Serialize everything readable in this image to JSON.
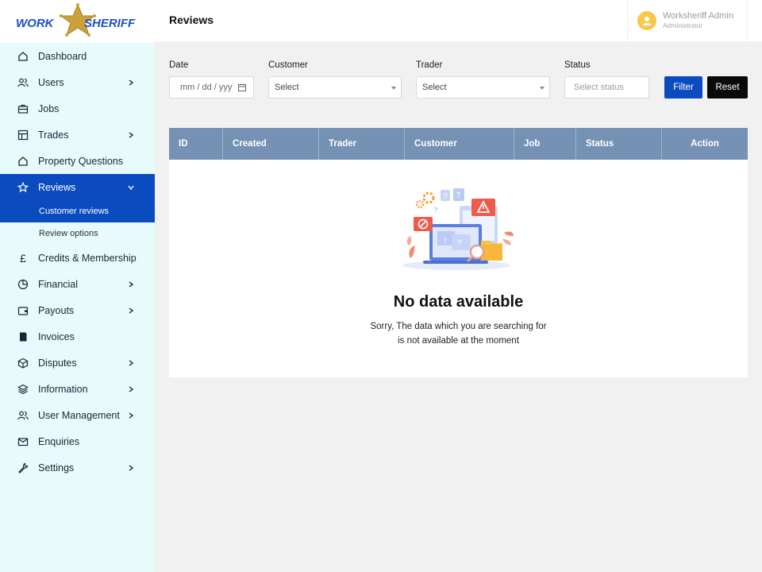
{
  "brand": {
    "left": "WORK",
    "right": "SHERIFF",
    "color": "#1c4ec6",
    "star_color": "#c9a23a"
  },
  "header": {
    "title": "Reviews"
  },
  "user": {
    "name": "Worksheriff Admin",
    "role": "Administrator"
  },
  "sidebar": {
    "items": [
      {
        "label": "Dashboard",
        "icon": "home-icon",
        "chevron": false
      },
      {
        "label": "Users",
        "icon": "users-icon",
        "chevron": true
      },
      {
        "label": "Jobs",
        "icon": "briefcase-icon",
        "chevron": false
      },
      {
        "label": "Trades",
        "icon": "grid-icon",
        "chevron": true
      },
      {
        "label": "Property Questions",
        "icon": "home-icon",
        "chevron": false
      },
      {
        "label": "Reviews",
        "icon": "star-icon",
        "chevron": true,
        "expanded": true
      },
      {
        "label": "Credits & Membership",
        "icon": "pound-icon",
        "chevron": false
      },
      {
        "label": "Financial",
        "icon": "pie-chart-icon",
        "chevron": true
      },
      {
        "label": "Payouts",
        "icon": "wallet-icon",
        "chevron": true
      },
      {
        "label": "Invoices",
        "icon": "invoice-icon",
        "chevron": false
      },
      {
        "label": "Disputes",
        "icon": "box-icon",
        "chevron": true
      },
      {
        "label": "Information",
        "icon": "layers-icon",
        "chevron": true
      },
      {
        "label": "User Management",
        "icon": "users-icon",
        "chevron": true
      },
      {
        "label": "Enquiries",
        "icon": "mail-icon",
        "chevron": false
      },
      {
        "label": "Settings",
        "icon": "wrench-icon",
        "chevron": true
      }
    ],
    "reviews_sub": [
      {
        "label": "Customer reviews",
        "active": true
      },
      {
        "label": "Review options",
        "active": false
      }
    ]
  },
  "filters": {
    "date": {
      "label": "Date",
      "placeholder": "mm / dd / yyyy"
    },
    "customer": {
      "label": "Customer",
      "value": "Select"
    },
    "trader": {
      "label": "Trader",
      "value": "Select"
    },
    "status": {
      "label": "Status",
      "placeholder": "Select status"
    },
    "filter_button": "Filter",
    "reset_button": "Reset"
  },
  "table": {
    "columns": [
      "ID",
      "Created",
      "Trader",
      "Customer",
      "Job",
      "Status",
      "Action"
    ],
    "rows": []
  },
  "empty_state": {
    "title": "No data available",
    "line1": "Sorry, The data which you are searching for",
    "line2": "is not available at the moment"
  },
  "colors": {
    "accent": "#0a4bbf",
    "sidebar_bg": "#e7fbfc",
    "table_header": "#7591b4",
    "reset_button": "#0a0a0a"
  }
}
